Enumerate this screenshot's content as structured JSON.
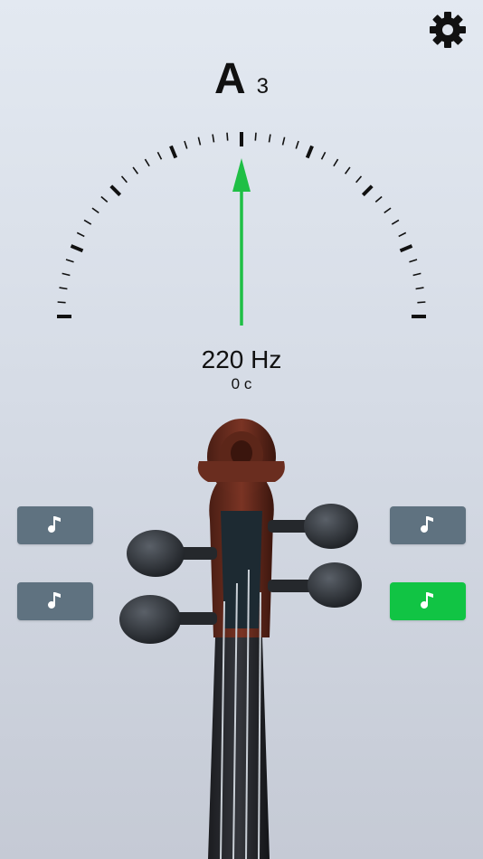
{
  "tuner": {
    "note": "A",
    "octave": "3",
    "frequency_label": "220 Hz",
    "cents_label": "0 c",
    "cents_value": 0
  },
  "colors": {
    "needle": "#1fbf45",
    "button": "#5f7280",
    "button_active": "#11c444"
  },
  "icons": {
    "settings": "gear-icon",
    "string_note": "music-note-icon"
  },
  "string_buttons": [
    {
      "id": "left-top",
      "active": false
    },
    {
      "id": "left-bottom",
      "active": false
    },
    {
      "id": "right-top",
      "active": false
    },
    {
      "id": "right-bottom",
      "active": true
    }
  ]
}
